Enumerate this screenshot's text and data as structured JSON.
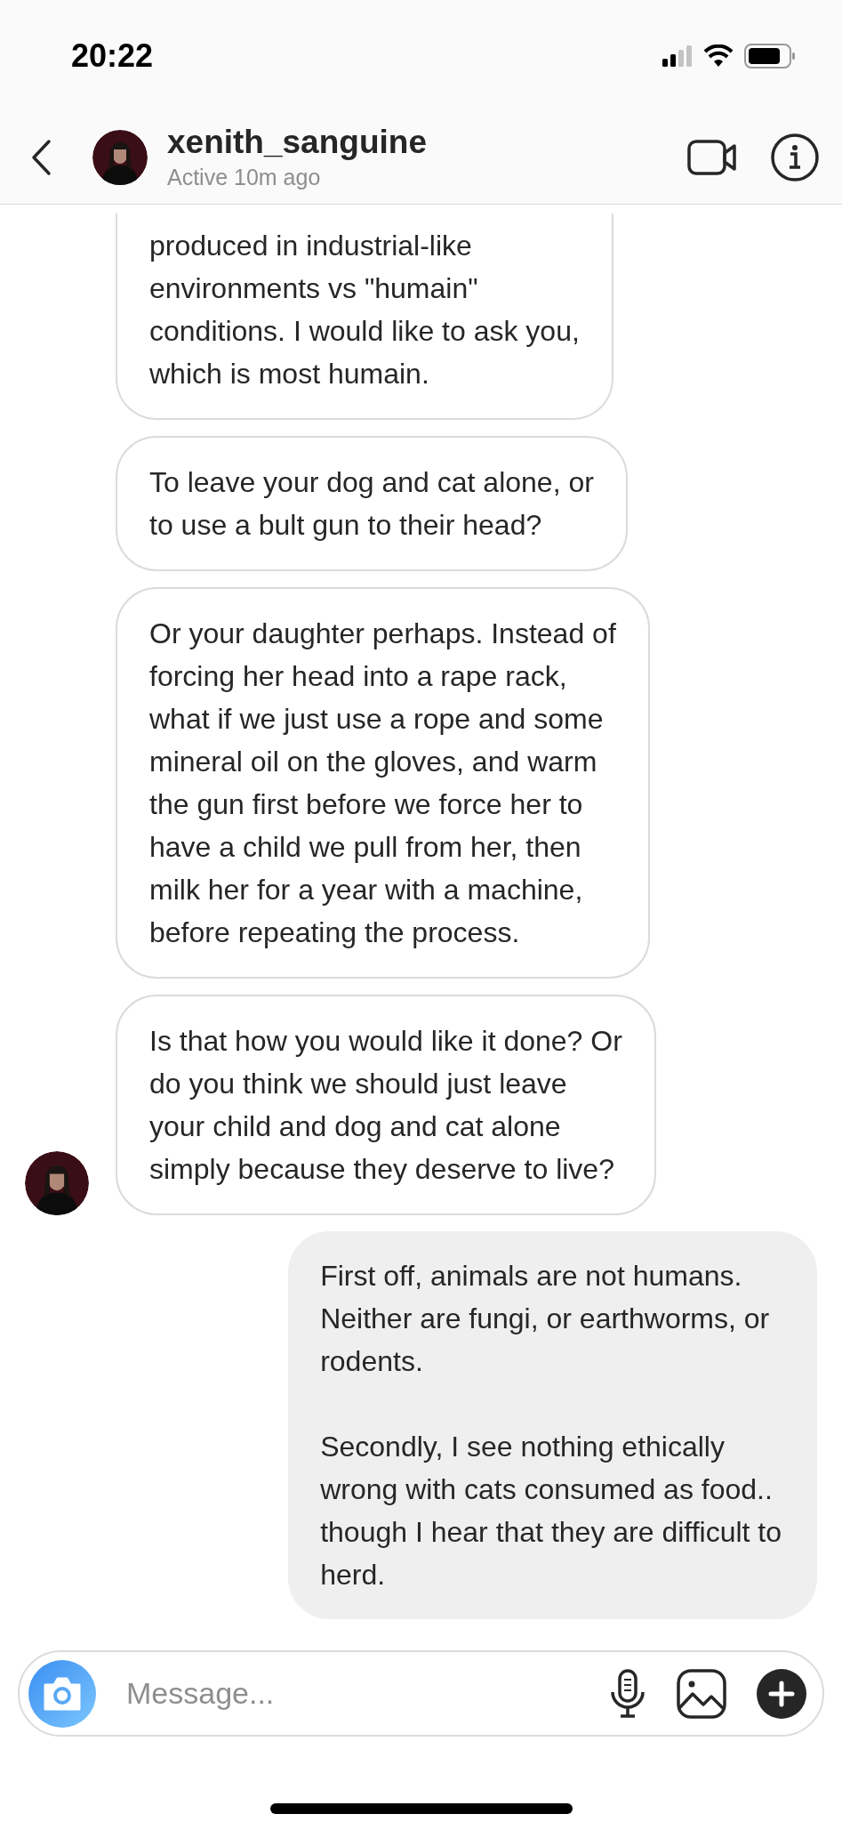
{
  "status_bar": {
    "time": "20:22"
  },
  "header": {
    "username": "xenith_sanguine",
    "status": "Active 10m ago"
  },
  "messages": [
    {
      "kind": "incoming",
      "show_avatar": false,
      "text": "produced in industrial-like\nenvironments vs \"humain\"\nconditions. I would like to ask you,\nwhich is most humain."
    },
    {
      "kind": "incoming",
      "show_avatar": false,
      "text": "To leave your dog and cat alone, or\nto use a bult gun to their head?"
    },
    {
      "kind": "incoming",
      "show_avatar": false,
      "text": "Or your daughter perhaps. Instead of\nforcing her head into a rape rack,\nwhat if we just use a rope and some\nmineral oil on the gloves, and warm\nthe gun first before we force her to\nhave a child we pull from her, then\nmilk her for a year with a machine,\nbefore repeating the process."
    },
    {
      "kind": "incoming",
      "show_avatar": true,
      "text": "Is that how you would like it done? Or\ndo you think we should just leave\nyour child and dog and cat alone\nsimply because they deserve to live?"
    },
    {
      "kind": "outgoing",
      "text": "First off, animals are not humans.\nNeither are fungi, or earthworms, or\nrodents.\n\nSecondly, I see nothing ethically\nwrong with cats consumed as food..\nthough I hear that they are difficult to\nherd."
    }
  ],
  "composer": {
    "placeholder": "Message..."
  }
}
